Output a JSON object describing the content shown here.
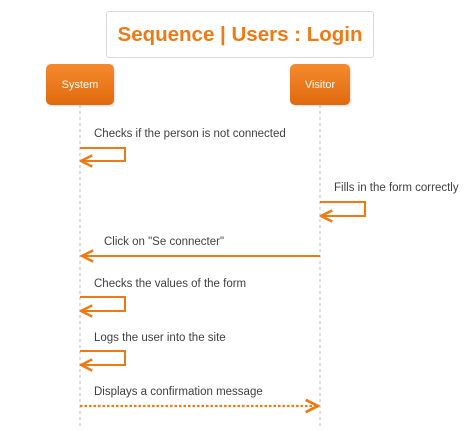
{
  "diagram": {
    "title": "Sequence | Users : Login",
    "accent_color": "#ee7a16",
    "lifeline_color": "#bcbcbc",
    "participants": [
      {
        "id": "system",
        "label": "System"
      },
      {
        "id": "visitor",
        "label": "Visitor"
      }
    ],
    "messages": [
      {
        "from": "system",
        "to": "system",
        "kind": "self",
        "style": "solid",
        "label": "Checks if the person is not connected"
      },
      {
        "from": "visitor",
        "to": "visitor",
        "kind": "self",
        "style": "solid",
        "label": "Fills in the form correctly"
      },
      {
        "from": "visitor",
        "to": "system",
        "kind": "call",
        "style": "solid",
        "label": "Click on \"Se connecter\""
      },
      {
        "from": "system",
        "to": "system",
        "kind": "self",
        "style": "solid",
        "label": "Checks the values of the form"
      },
      {
        "from": "system",
        "to": "system",
        "kind": "self",
        "style": "solid",
        "label": "Logs the user into the site"
      },
      {
        "from": "system",
        "to": "visitor",
        "kind": "reply",
        "style": "dotted",
        "label": "Displays a confirmation message"
      }
    ]
  }
}
